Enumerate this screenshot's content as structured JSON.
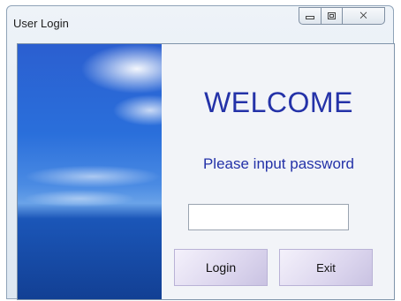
{
  "window": {
    "title": "User Login",
    "controls": {
      "minimize_icon": "minimize-icon",
      "maximize_icon": "maximize-icon",
      "close_icon": "close-icon",
      "close_glyph": "⨉"
    }
  },
  "content": {
    "heading": "WELCOME",
    "prompt": "Please input password",
    "password": {
      "value": "",
      "placeholder": ""
    },
    "buttons": {
      "login": "Login",
      "exit": "Exit"
    }
  },
  "colors": {
    "text_accent": "#2432a8",
    "button_fill": "#dcd6ee",
    "sky_blue": "#2a6fdb"
  }
}
